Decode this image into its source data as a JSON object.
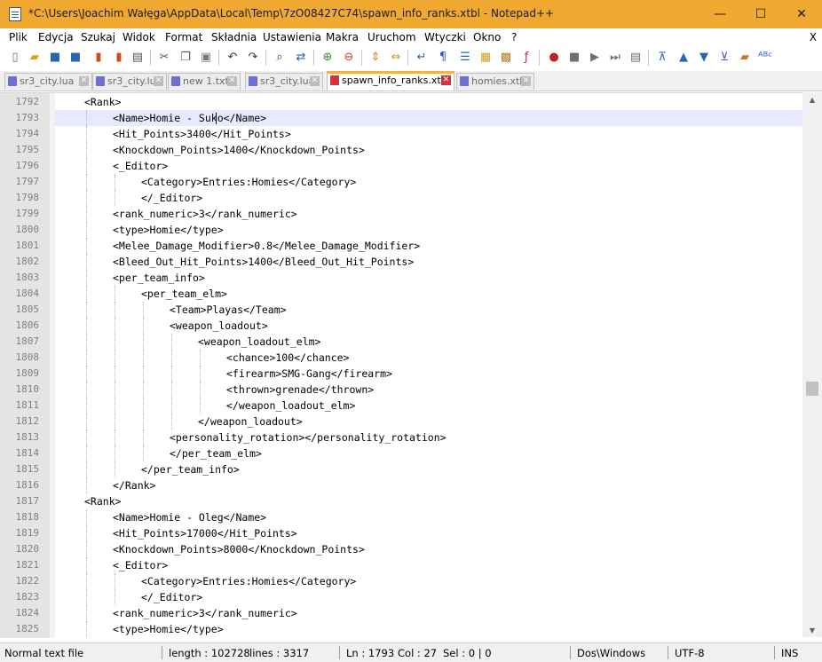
{
  "window": {
    "title": "*C:\\Users\\Joachim Wałęga\\AppData\\Local\\Temp\\7zO08427C74\\spawn_info_ranks.xtbl - Notepad++",
    "minimize": "—",
    "maximize": "☐",
    "close": "✕"
  },
  "menu": {
    "items": [
      "Plik",
      "Edycja",
      "Szukaj",
      "Widok",
      "Format",
      "Składnia",
      "Ustawienia",
      "Makra",
      "Uruchom",
      "Wtyczki",
      "Okno",
      "?"
    ],
    "close_glyph": "X"
  },
  "toolbar": {
    "buttons": [
      {
        "name": "new-file-icon",
        "glyph": "▯",
        "color": "#4c8a2a"
      },
      {
        "name": "open-file-icon",
        "glyph": "▰",
        "color": "#d9a21b"
      },
      {
        "name": "save-icon",
        "glyph": "■",
        "color": "#2c63b0"
      },
      {
        "name": "save-all-icon",
        "glyph": "■",
        "color": "#2c63b0"
      },
      {
        "name": "close-file-icon",
        "glyph": "▮",
        "color": "#d04a1c"
      },
      {
        "name": "close-all-icon",
        "glyph": "▮",
        "color": "#d04a1c"
      },
      {
        "name": "print-icon",
        "glyph": "▤",
        "color": "#555555"
      },
      {
        "name": "cut-icon",
        "glyph": "✂",
        "color": "#555555"
      },
      {
        "name": "copy-icon",
        "glyph": "❐",
        "color": "#555555"
      },
      {
        "name": "paste-icon",
        "glyph": "▣",
        "color": "#777777"
      },
      {
        "name": "undo-icon",
        "glyph": "↶",
        "color": "#3a3a3a"
      },
      {
        "name": "redo-icon",
        "glyph": "↷",
        "color": "#3a3a3a"
      },
      {
        "name": "find-icon",
        "glyph": "⌕",
        "color": "#3a3a3a"
      },
      {
        "name": "replace-icon",
        "glyph": "⇄",
        "color": "#2c63b0"
      },
      {
        "name": "zoom-in-icon",
        "glyph": "⊕",
        "color": "#2f8a2f"
      },
      {
        "name": "zoom-out-icon",
        "glyph": "⊖",
        "color": "#c04020"
      },
      {
        "name": "sync-vertical-icon",
        "glyph": "⇕",
        "color": "#d08a1c"
      },
      {
        "name": "sync-horizontal-icon",
        "glyph": "⇔",
        "color": "#d08a1c"
      },
      {
        "name": "word-wrap-icon",
        "glyph": "↵",
        "color": "#2c63b0"
      },
      {
        "name": "show-all-chars-icon",
        "glyph": "¶",
        "color": "#2c63b0"
      },
      {
        "name": "indent-guide-icon",
        "glyph": "☰",
        "color": "#2c63b0"
      },
      {
        "name": "user-language-icon",
        "glyph": "▦",
        "color": "#d0a020"
      },
      {
        "name": "doc-map-icon",
        "glyph": "▩",
        "color": "#b08020"
      },
      {
        "name": "function-list-icon",
        "glyph": "ƒ",
        "color": "#c03030"
      },
      {
        "name": "record-macro-icon",
        "glyph": "●",
        "color": "#c02020"
      },
      {
        "name": "stop-macro-icon",
        "glyph": "■",
        "color": "#707070"
      },
      {
        "name": "play-macro-icon",
        "glyph": "▶",
        "color": "#707070"
      },
      {
        "name": "play-macro-multiple-icon",
        "glyph": "⏭",
        "color": "#707070"
      },
      {
        "name": "save-macro-icon",
        "glyph": "▤",
        "color": "#707070"
      },
      {
        "name": "fold-all-icon",
        "glyph": "⊼",
        "color": "#2c63b0"
      },
      {
        "name": "move-up-icon",
        "glyph": "▲",
        "color": "#2c63b0"
      },
      {
        "name": "move-down-icon",
        "glyph": "▼",
        "color": "#2c63b0"
      },
      {
        "name": "unfold-all-icon",
        "glyph": "⊻",
        "color": "#2c63b0"
      },
      {
        "name": "bookmark-icon",
        "glyph": "▰",
        "color": "#c08020"
      },
      {
        "name": "spell-check-icon",
        "glyph": "ᴬᴮᶜ",
        "color": "#2c63b0"
      }
    ]
  },
  "tabs": [
    {
      "label": "sr3_city.lua",
      "active": false,
      "icon_color": "#6f6fd0"
    },
    {
      "label": "sr3_city.lua",
      "active": false,
      "icon_color": "#6f6fd0"
    },
    {
      "label": "new 1.txt",
      "active": false,
      "icon_color": "#6f6fd0"
    },
    {
      "label": "sr3_city.lua",
      "active": false,
      "icon_color": "#6f6fd0"
    },
    {
      "label": "spawn_info_ranks.xtbl",
      "active": true,
      "icon_color": "#d13438"
    },
    {
      "label": "homies.xtbl",
      "active": false,
      "icon_color": "#6f6fd0"
    }
  ],
  "tab_close_glyph": "✕",
  "editor": {
    "lines": [
      {
        "n": "1792",
        "indent": 1,
        "text": "<Rank>"
      },
      {
        "n": "1793",
        "indent": 2,
        "text": "<Name>Homie - Suko</Name>",
        "current": true
      },
      {
        "n": "1794",
        "indent": 2,
        "text": "<Hit_Points>3400</Hit_Points>"
      },
      {
        "n": "1795",
        "indent": 2,
        "text": "<Knockdown_Points>1400</Knockdown_Points>"
      },
      {
        "n": "1796",
        "indent": 2,
        "text": "<_Editor>"
      },
      {
        "n": "1797",
        "indent": 3,
        "text": "<Category>Entries:Homies</Category>"
      },
      {
        "n": "1798",
        "indent": 3,
        "text": "</_Editor>"
      },
      {
        "n": "1799",
        "indent": 2,
        "text": "<rank_numeric>3</rank_numeric>"
      },
      {
        "n": "1800",
        "indent": 2,
        "text": "<type>Homie</type>"
      },
      {
        "n": "1801",
        "indent": 2,
        "text": "<Melee_Damage_Modifier>0.8</Melee_Damage_Modifier>"
      },
      {
        "n": "1802",
        "indent": 2,
        "text": "<Bleed_Out_Hit_Points>1400</Bleed_Out_Hit_Points>"
      },
      {
        "n": "1803",
        "indent": 2,
        "text": "<per_team_info>"
      },
      {
        "n": "1804",
        "indent": 3,
        "text": "<per_team_elm>"
      },
      {
        "n": "1805",
        "indent": 4,
        "text": "<Team>Playas</Team>"
      },
      {
        "n": "1806",
        "indent": 4,
        "text": "<weapon_loadout>"
      },
      {
        "n": "1807",
        "indent": 5,
        "text": "<weapon_loadout_elm>"
      },
      {
        "n": "1808",
        "indent": 6,
        "text": "<chance>100</chance>"
      },
      {
        "n": "1809",
        "indent": 6,
        "text": "<firearm>SMG-Gang</firearm>"
      },
      {
        "n": "1810",
        "indent": 6,
        "text": "<thrown>grenade</thrown>"
      },
      {
        "n": "1811",
        "indent": 6,
        "text": "</weapon_loadout_elm>"
      },
      {
        "n": "1812",
        "indent": 5,
        "text": "</weapon_loadout>"
      },
      {
        "n": "1813",
        "indent": 4,
        "text": "<personality_rotation></personality_rotation>"
      },
      {
        "n": "1814",
        "indent": 4,
        "text": "</per_team_elm>"
      },
      {
        "n": "1815",
        "indent": 3,
        "text": "</per_team_info>"
      },
      {
        "n": "1816",
        "indent": 2,
        "text": "</Rank>"
      },
      {
        "n": "1817",
        "indent": 1,
        "text": "<Rank>"
      },
      {
        "n": "1818",
        "indent": 2,
        "text": "<Name>Homie - Oleg</Name>"
      },
      {
        "n": "1819",
        "indent": 2,
        "text": "<Hit_Points>17000</Hit_Points>"
      },
      {
        "n": "1820",
        "indent": 2,
        "text": "<Knockdown_Points>8000</Knockdown_Points>"
      },
      {
        "n": "1821",
        "indent": 2,
        "text": "<_Editor>"
      },
      {
        "n": "1822",
        "indent": 3,
        "text": "<Category>Entries:Homies</Category>"
      },
      {
        "n": "1823",
        "indent": 3,
        "text": "</_Editor>"
      },
      {
        "n": "1824",
        "indent": 2,
        "text": "<rank_numeric>3</rank_numeric>"
      },
      {
        "n": "1825",
        "indent": 2,
        "text": "<type>Homie</type>"
      }
    ],
    "caret": {
      "line": "1793",
      "col": 27
    }
  },
  "scrollbar": {
    "up_glyph": "▲",
    "down_glyph": "▼"
  },
  "status": {
    "file_type": "Normal text file",
    "length": "length : 102728",
    "lines": "lines : 3317",
    "position": "Ln : 1793",
    "column": "Col : 27",
    "selection": "Sel : 0 | 0",
    "eol": "Dos\\Windows",
    "encoding": "UTF-8",
    "mode": "INS"
  }
}
